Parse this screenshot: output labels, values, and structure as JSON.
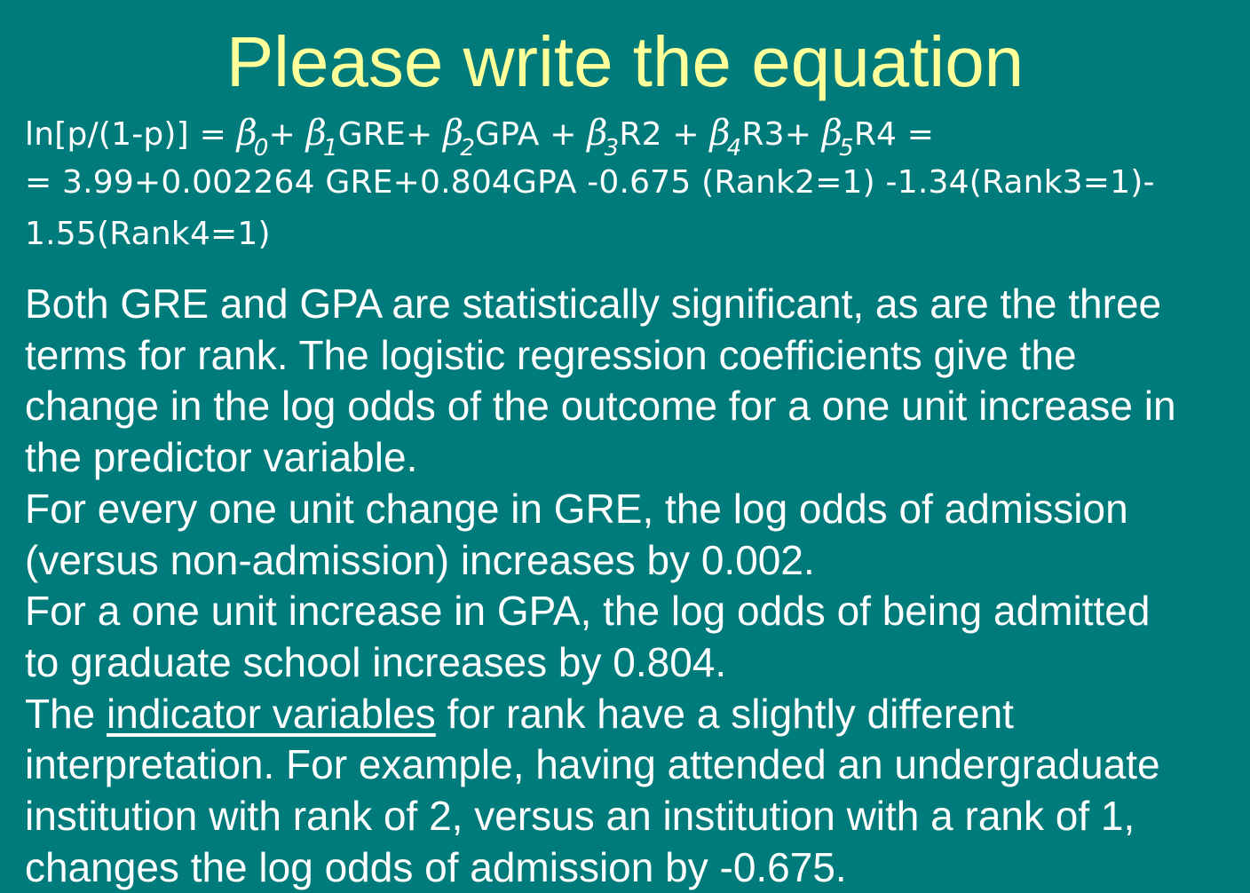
{
  "title": "Please write the equation",
  "equation": {
    "lhs": "ln[p/(1-p)] = ",
    "beta": "β",
    "sub0": "0",
    "sub1": "1",
    "sub2": "2",
    "sub3": "3",
    "sub4": "4",
    "sub5": "5",
    "plus_after_b0": "+ ",
    "term1": "GRE+ ",
    "term2": "GPA + ",
    "term3": "R2 + ",
    "term4": "R3+ ",
    "term5": "R4 =",
    "line2": "= 3.99+0.002264 GRE+0.804GPA -0.675 (Rank2=1) -1.34(Rank3=1)-",
    "line3": "1.55(Rank4=1)"
  },
  "body": {
    "lines": [
      "Both GRE and GPA are statistically significant, as are the three",
      "terms for rank. The logistic regression coefficients give the",
      "change in the log odds of the outcome for a one unit increase in",
      "the predictor variable.",
      "For every one unit change in GRE, the log odds of admission",
      "(versus non-admission) increases by 0.002.",
      "For a one unit increase in GPA, the log odds of being admitted",
      "to graduate school increases by 0.804."
    ],
    "indicator_prefix": "The ",
    "indicator_link": "indicator variables",
    "indicator_suffix": " for rank have a slightly different",
    "tail_lines": [
      "interpretation. For example, having attended an undergraduate",
      "institution with rank of 2, versus an institution with a rank of 1,",
      "changes the log odds of admission by -0.675."
    ]
  },
  "colors": {
    "background": "#007B7B",
    "title": "#FFFF99",
    "text": "#FFFFFF"
  }
}
